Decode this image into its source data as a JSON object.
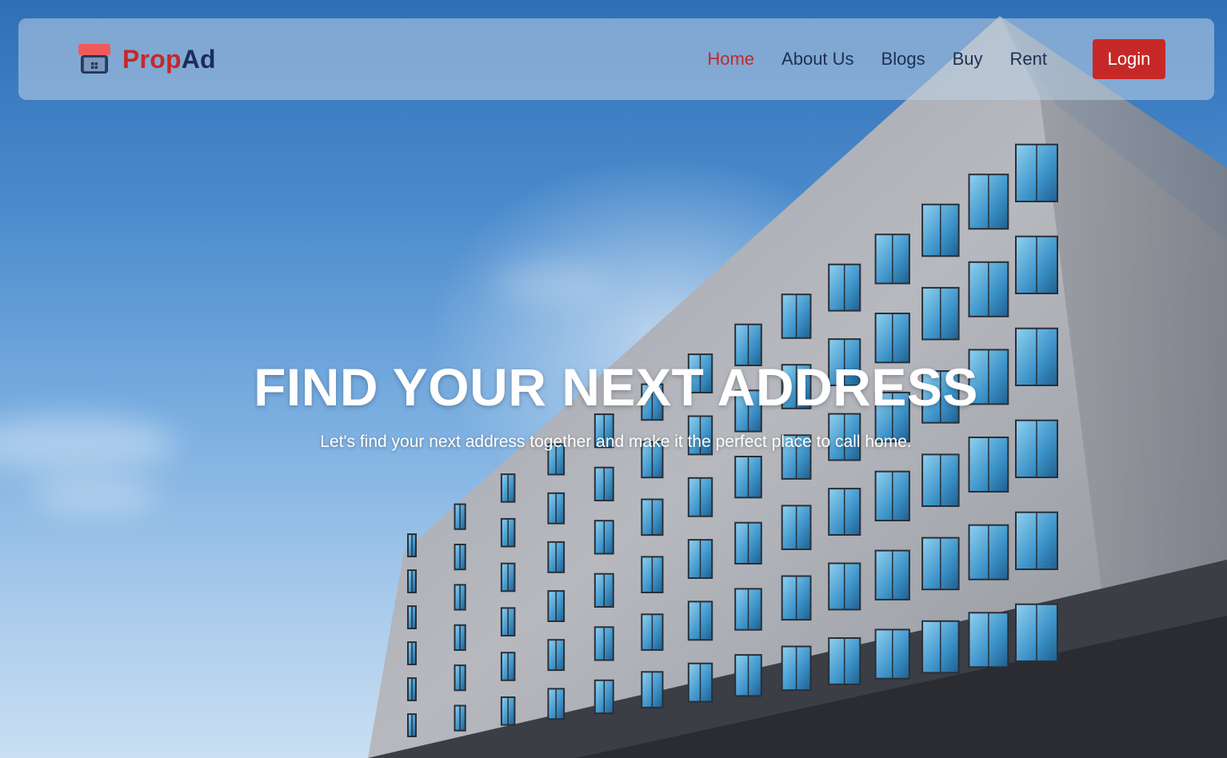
{
  "brand": {
    "name_part1": "Prop",
    "name_part2": "Ad",
    "icon": "house-icon"
  },
  "nav": {
    "items": [
      {
        "label": "Home",
        "active": true
      },
      {
        "label": "About Us",
        "active": false
      },
      {
        "label": "Blogs",
        "active": false
      },
      {
        "label": "Buy",
        "active": false
      },
      {
        "label": "Rent",
        "active": false
      }
    ],
    "login_label": "Login"
  },
  "hero": {
    "title": "FIND YOUR NEXT ADDRESS",
    "subtitle": "Let's find your next address together and make it the perfect place to call home."
  },
  "colors": {
    "accent": "#c62828",
    "brand_dark": "#1d2c5a",
    "nav_text": "#1e2f52"
  }
}
